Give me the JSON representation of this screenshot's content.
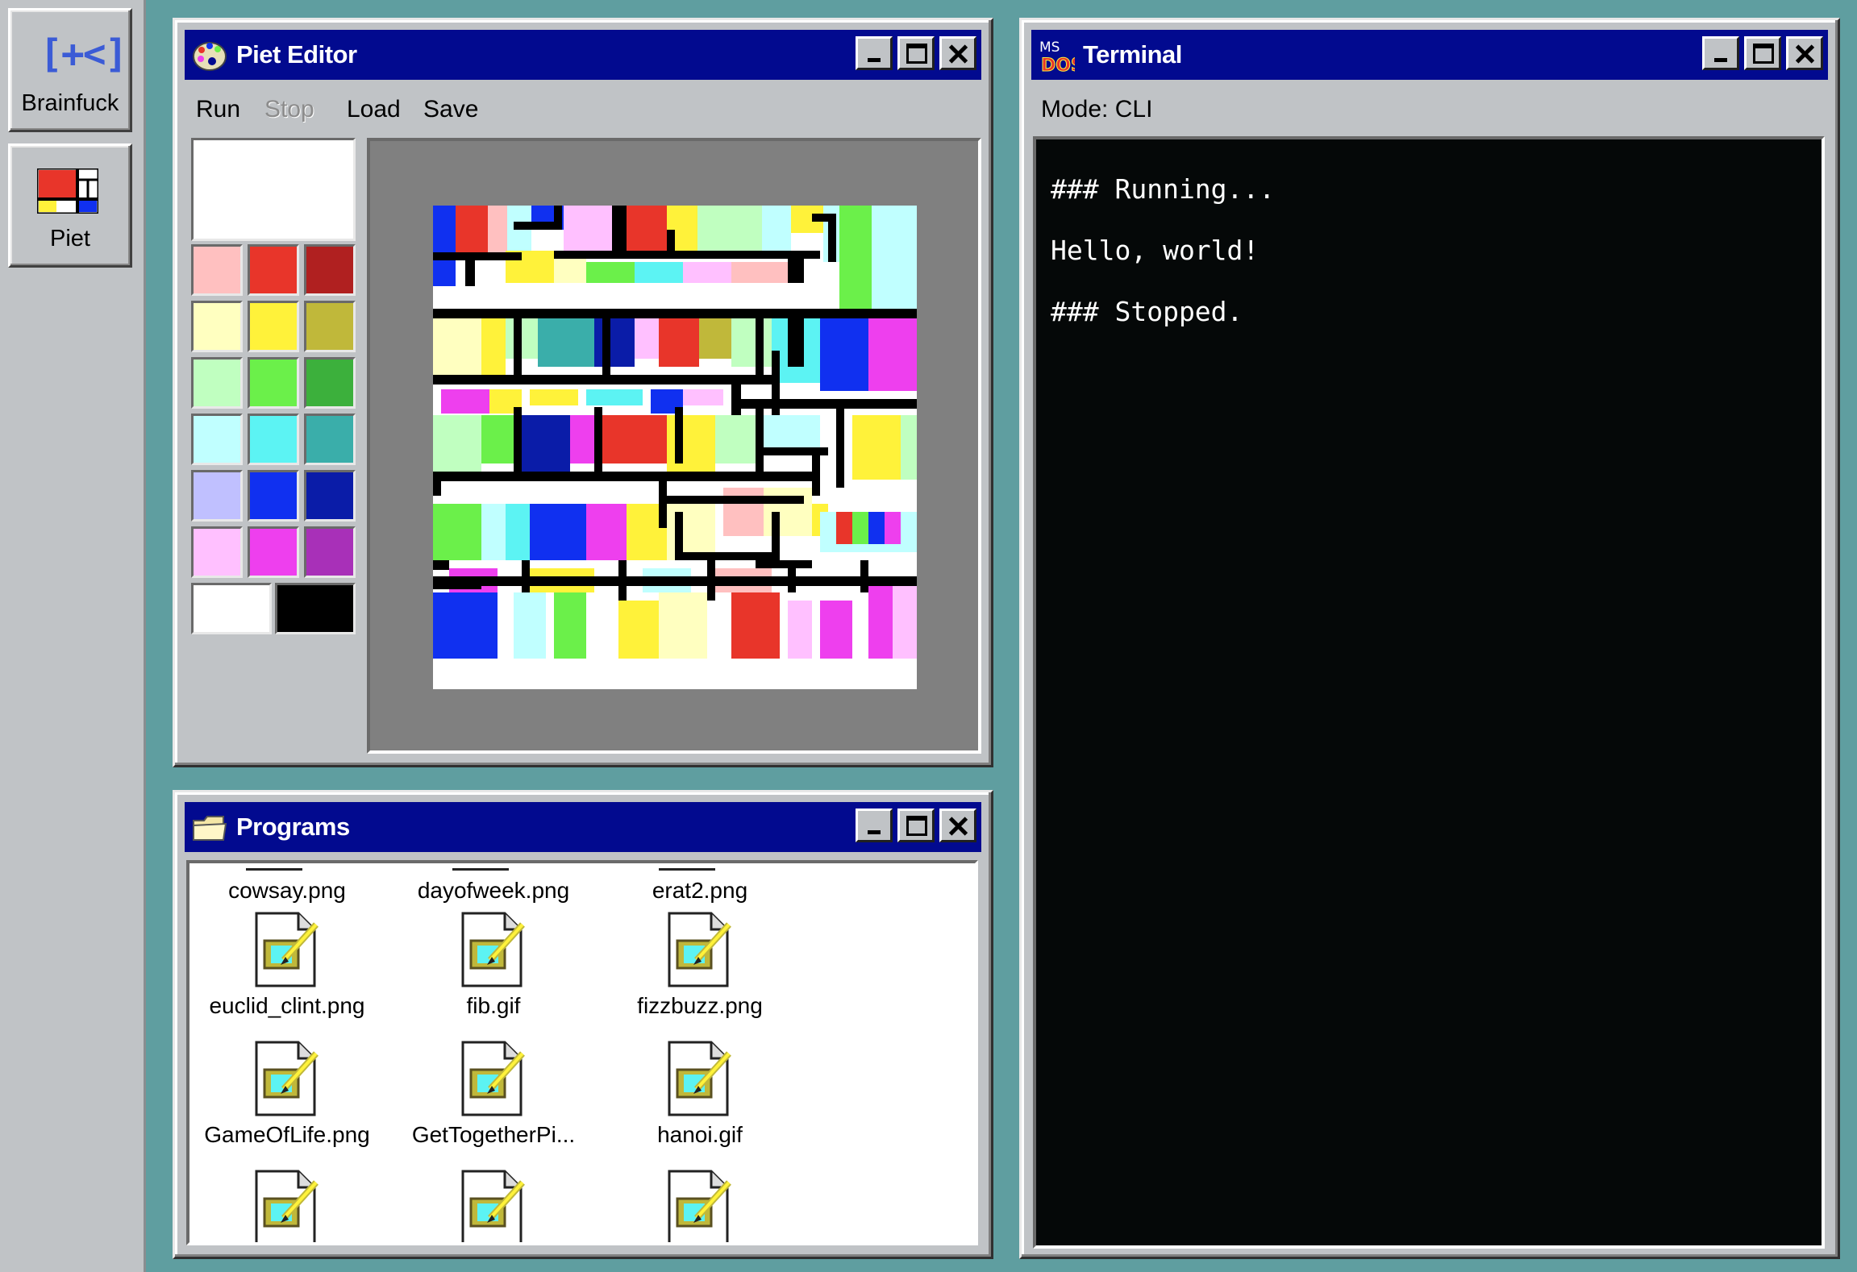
{
  "dock": {
    "items": [
      {
        "label": "Brainfuck",
        "icon": "brainfuck-icon",
        "glyph": "[+<]"
      },
      {
        "label": "Piet",
        "icon": "mondrian-icon"
      }
    ]
  },
  "piet_editor": {
    "title": "Piet Editor",
    "menu": {
      "run": "Run",
      "stop": "Stop",
      "load": "Load",
      "save": "Save"
    },
    "palette": {
      "current": "#ffffff",
      "rows": [
        [
          "#ffc0c0",
          "#e8352a",
          "#b02020"
        ],
        [
          "#ffffc0",
          "#fff23a",
          "#c0b83a"
        ],
        [
          "#c0ffc0",
          "#6bf04a",
          "#3cb03c"
        ],
        [
          "#c0ffff",
          "#5cf3f3",
          "#3aaeaa"
        ],
        [
          "#c0c0ff",
          "#1030f0",
          "#0a1ca8"
        ],
        [
          "#ffc0ff",
          "#ee3fee",
          "#a830b8"
        ]
      ],
      "extra": [
        "#ffffff",
        "#000000"
      ]
    }
  },
  "terminal": {
    "title": "Terminal",
    "mode_label": "Mode: CLI",
    "lines": [
      "### Running...",
      "Hello, world!",
      "### Stopped."
    ]
  },
  "programs": {
    "title": "Programs",
    "files": [
      "cowsay.png",
      "dayofweek.png",
      "erat2.png",
      "euclid_clint.png",
      "fib.gif",
      "fizzbuzz.png",
      "GameOfLife.png",
      "GetTogetherPi...",
      "hanoi.gif",
      "",
      "",
      ""
    ]
  },
  "colors": {
    "desktop": "#5f9ea0",
    "titlebar": "#020a8f",
    "window": "#c0c3c6"
  }
}
